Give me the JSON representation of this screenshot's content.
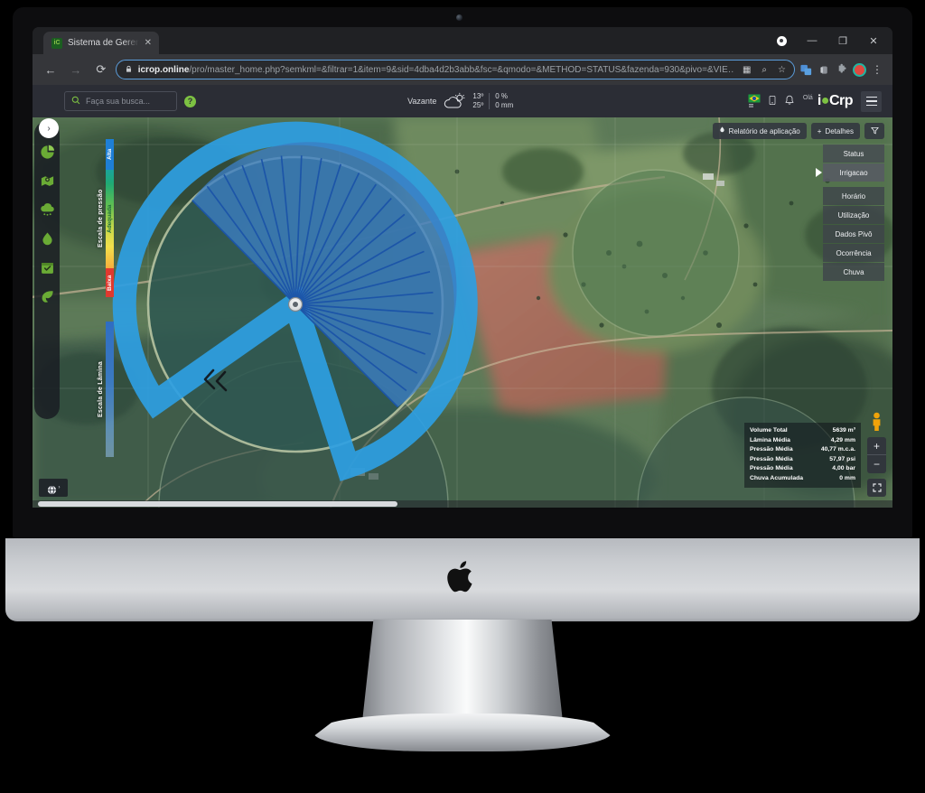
{
  "browser": {
    "tab": {
      "favicon_label": "iC",
      "title": "Sistema de Geren",
      "close_label": "✕"
    },
    "window_controls": {
      "profile": "●",
      "minimize": "—",
      "maximize": "❐",
      "close": "✕"
    },
    "nav": {
      "back": "←",
      "forward": "→",
      "reload": "⟳"
    },
    "omnibox": {
      "lock_icon": "🔒",
      "url_domain": "icrop.online",
      "url_path": "/pro/master_home.php?semkml=&filtrar=1&item=9&sid=4dba4d2b3abb&fsc=&qmodo=&METHOD=STATUS&fazenda=930&pivo=&VIE…",
      "qr_icon": "▦",
      "search_icon": "⌕",
      "bookmark_icon": "☆"
    },
    "toolbar": {
      "menu_icon": "⋮"
    }
  },
  "app": {
    "search": {
      "placeholder": "Faça sua busca...",
      "value": "",
      "icon": "search-icon"
    },
    "help_label": "?",
    "weather": {
      "city": "Vazante",
      "temp_high": "13º",
      "temp_low": "25º",
      "precip_chance": "0 %",
      "precip_amount": "0 mm"
    },
    "header_right": {
      "greeting": "Olá",
      "logo_prefix": "i",
      "logo_main": "Cr",
      "logo_suffix": "p",
      "flag_icon": "brazil-flag-icon",
      "phone_icon": "phone-icon",
      "bell_icon": "bell-icon"
    },
    "rail_icons": [
      {
        "name": "rail-toggle",
        "glyph": "›"
      },
      {
        "name": "pie-chart-icon"
      },
      {
        "name": "map-pin-icon"
      },
      {
        "name": "cloud-rain-icon"
      },
      {
        "name": "water-drop-icon"
      },
      {
        "name": "calendar-icon"
      },
      {
        "name": "leaf-icon"
      }
    ],
    "legends": {
      "pressure": {
        "title": "Escala de pressão",
        "high": "Alta",
        "mid": "Adequada",
        "low": "Baixa"
      },
      "lamina": {
        "title": "Escala de Lâmina"
      }
    },
    "map_toolbar": {
      "report_button": "Relatório de aplicação",
      "details_button": "Detalhes",
      "details_prefix": "+",
      "drop_icon": "💧",
      "filter_icon": "▽"
    },
    "menu": [
      {
        "label": "Status",
        "active": false,
        "sub": false
      },
      {
        "label": "Irrigacao",
        "active": true,
        "sub": false
      },
      {
        "label": "Horário",
        "active": false,
        "sub": true
      },
      {
        "label": "Utilização",
        "active": false,
        "sub": true
      },
      {
        "label": "Dados Pivô",
        "active": false,
        "sub": true
      },
      {
        "label": "Ocorrência",
        "active": false,
        "sub": true
      },
      {
        "label": "Chuva",
        "active": false,
        "sub": true
      }
    ],
    "stats": [
      {
        "label": "Volume Total",
        "value": "5639 m³"
      },
      {
        "label": "Lâmina Média",
        "value": "4,29 mm"
      },
      {
        "label": "Pressão Média",
        "value": "40,77 m.c.a."
      },
      {
        "label": "Pressão Média",
        "value": "57,97 psi"
      },
      {
        "label": "Pressão Média",
        "value": "4,00 bar"
      },
      {
        "label": "Chuva Acumulada",
        "value": "0 mm"
      }
    ],
    "map_controls": {
      "pegman": "street-view-pegman",
      "zoom_in": "+",
      "zoom_out": "−",
      "fullscreen": "⛶",
      "layer_caret": "›"
    }
  },
  "colors": {
    "brand_green": "#7dc242",
    "pivot_blue": "#1f6fc4",
    "pivot_band": "#2f9fe0",
    "header_bg": "#2b2d35"
  }
}
